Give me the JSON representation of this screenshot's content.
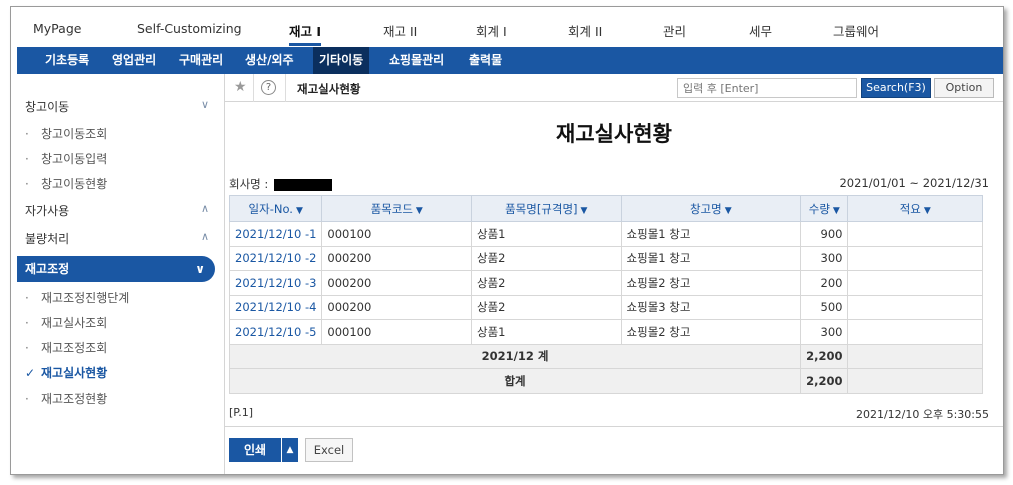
{
  "top_menu": [
    "MyPage",
    "Self-Customizing",
    "재고 I",
    "재고 II",
    "회계 I",
    "회계 II",
    "관리",
    "세무",
    "그룹웨어"
  ],
  "sub_menu": [
    "기초등록",
    "영업관리",
    "구매관리",
    "생산/외주",
    "기타이동",
    "쇼핑몰관리",
    "출력물"
  ],
  "sidebar": {
    "group_stock_move": "창고이동",
    "items_stock_move": [
      "창고이동조회",
      "창고이동입력",
      "창고이동현황"
    ],
    "group_self_use": "자가사용",
    "group_defect": "불량처리",
    "group_adjust": "재고조정",
    "items_adjust": [
      "재고조정진행단계",
      "재고실사조회",
      "재고조정조회",
      "재고실사현황",
      "재고조정현황"
    ]
  },
  "toolbar": {
    "breadcrumb": "재고실사현황",
    "search_placeholder": "입력 후 [Enter]",
    "search_button": "Search(F3)",
    "option_button": "Option"
  },
  "report": {
    "title": "재고실사현황",
    "company_label": "회사명 :",
    "period": "2021/01/01 ~ 2021/12/31",
    "columns": [
      "일자-No.",
      "품목코드",
      "품목명[규격명]",
      "창고명",
      "수량",
      "적요"
    ],
    "rows": [
      {
        "date_no": "2021/12/10 -1",
        "item_code": "000100",
        "item_name": "상품1",
        "warehouse": "쇼핑몰1 창고",
        "qty": "900",
        "memo": ""
      },
      {
        "date_no": "2021/12/10 -2",
        "item_code": "000200",
        "item_name": "상품2",
        "warehouse": "쇼핑몰1 창고",
        "qty": "300",
        "memo": ""
      },
      {
        "date_no": "2021/12/10 -3",
        "item_code": "000200",
        "item_name": "상품2",
        "warehouse": "쇼핑몰2 창고",
        "qty": "200",
        "memo": ""
      },
      {
        "date_no": "2021/12/10 -4",
        "item_code": "000200",
        "item_name": "상품2",
        "warehouse": "쇼핑몰3 창고",
        "qty": "500",
        "memo": ""
      },
      {
        "date_no": "2021/12/10 -5",
        "item_code": "000100",
        "item_name": "상품1",
        "warehouse": "쇼핑몰2 창고",
        "qty": "300",
        "memo": ""
      }
    ],
    "subtotal_label": "2021/12 계",
    "subtotal_qty": "2,200",
    "total_label": "합계",
    "total_qty": "2,200",
    "page_no": "[P.1]",
    "timestamp": "2021/12/10 오후 5:30:55"
  },
  "buttons": {
    "print": "인쇄",
    "print_dropdown": "▲",
    "excel": "Excel"
  },
  "colors": {
    "accent": "#1a57a3",
    "submenu_active": "#0b2f5e",
    "header_bg": "#e9eef5"
  }
}
